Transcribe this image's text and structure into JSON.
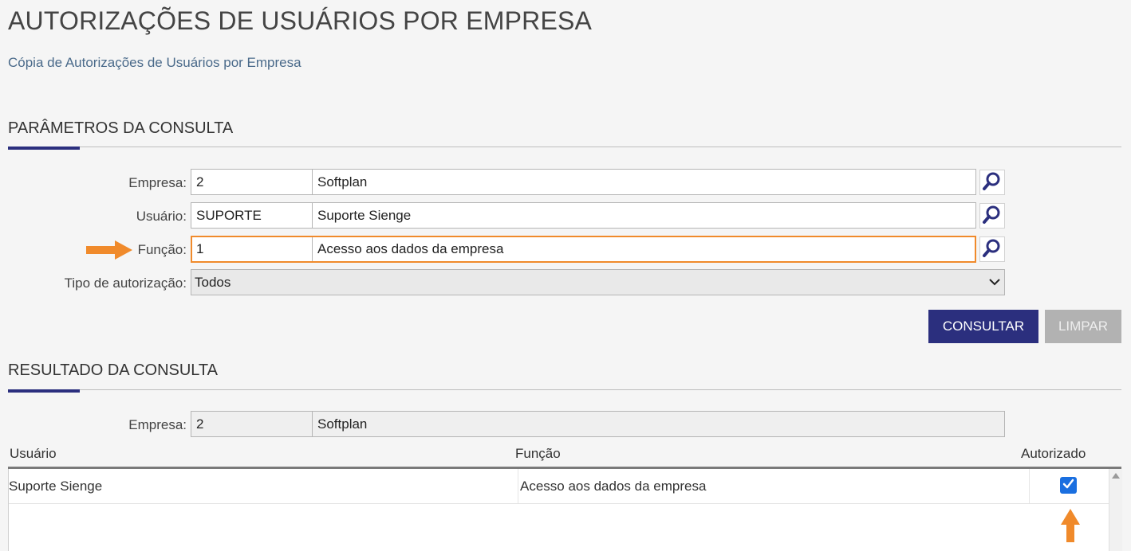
{
  "page": {
    "title": "AUTORIZAÇÕES DE USUÁRIOS POR EMPRESA",
    "subtitle_link": "Cópia de Autorizações de Usuários por Empresa"
  },
  "params": {
    "section_title": "PARÂMETROS DA CONSULTA",
    "empresa": {
      "label": "Empresa:",
      "code": "2",
      "name": "Softplan"
    },
    "usuario": {
      "label": "Usuário:",
      "code": "SUPORTE",
      "name": "Suporte Sienge"
    },
    "funcao": {
      "label": "Função:",
      "code": "1",
      "name": "Acesso aos dados da empresa"
    },
    "tipo": {
      "label": "Tipo de autorização:",
      "selected": "Todos"
    },
    "consultar_label": "CONSULTAR",
    "limpar_label": "LIMPAR"
  },
  "result": {
    "section_title": "RESULTADO DA CONSULTA",
    "empresa": {
      "label": "Empresa:",
      "code": "2",
      "name": "Softplan"
    },
    "columns": [
      "Usuário",
      "Função",
      "Autorizado"
    ],
    "rows": [
      {
        "usuario": "Suporte Sienge",
        "funcao": "Acesso aos dados da empresa",
        "autorizado": true
      }
    ]
  },
  "colors": {
    "primary": "#2b2f7e",
    "highlight": "#f08a2b",
    "checkbox": "#1a6fe0",
    "link": "#4a6a8a"
  },
  "icons": {
    "lookup": "search-icon",
    "dropdown": "chevron-down-icon",
    "check": "check-icon",
    "annotation": "arrow-icon"
  }
}
